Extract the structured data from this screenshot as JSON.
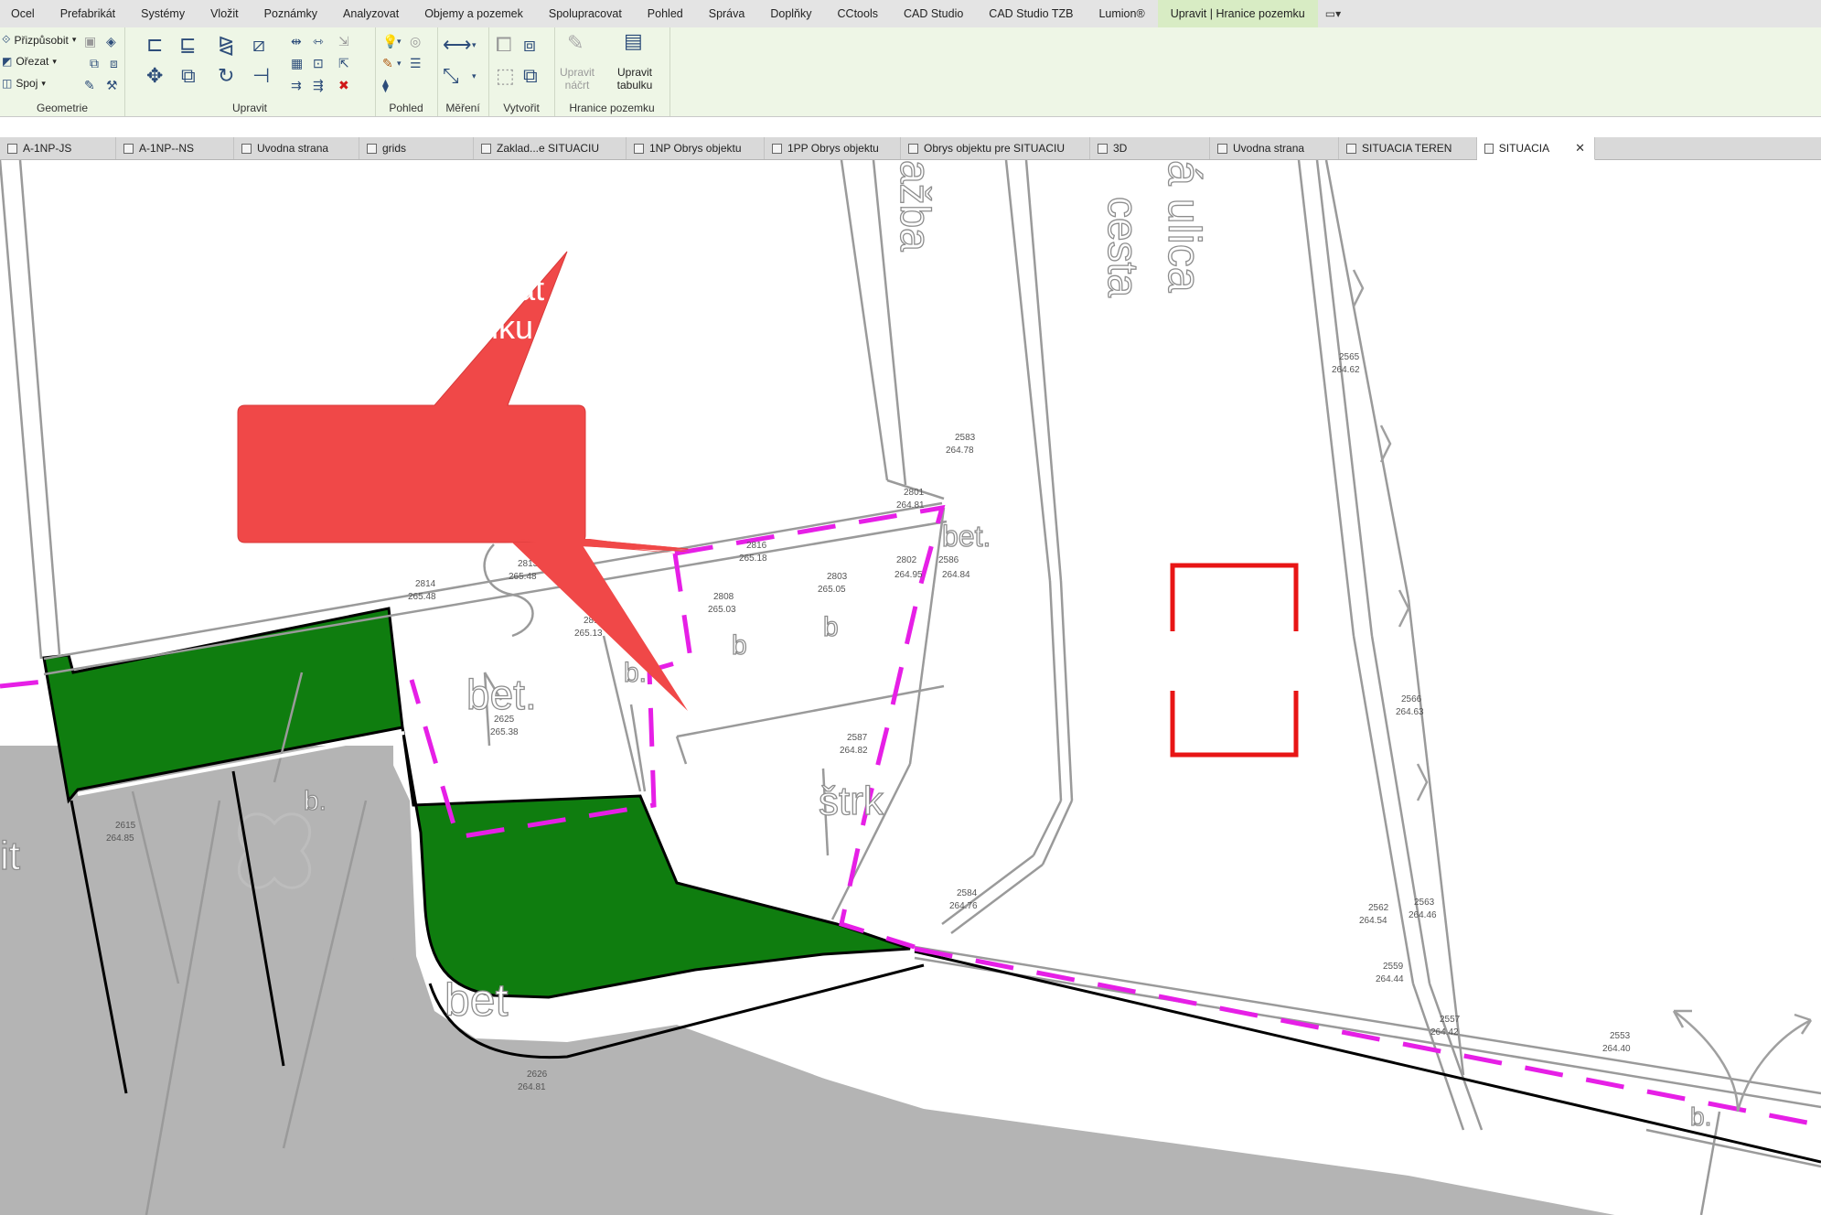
{
  "menu": {
    "items": [
      "Ocel",
      "Prefabrikát",
      "Systémy",
      "Vložit",
      "Poznámky",
      "Analyzovat",
      "Objemy a pozemek",
      "Spolupracovat",
      "Pohled",
      "Správa",
      "Doplňky",
      "CCtools",
      "CAD Studio",
      "CAD Studio TZB",
      "Lumion®",
      "Upravit | Hranice pozemku"
    ],
    "qat_icon": "switch-window-icon"
  },
  "ribbon": {
    "geometry": {
      "title": "Geometrie",
      "fit_label": "Přizpůsobit",
      "cut_label": "Ořezat",
      "join_label": "Spoj"
    },
    "modify": {
      "title": "Upravit"
    },
    "view": {
      "title": "Pohled"
    },
    "measure": {
      "title": "Měření"
    },
    "create": {
      "title": "Vytvořit"
    },
    "property_line": {
      "title": "Hranice pozemku",
      "edit_sketch_label_1": "Upravit",
      "edit_sketch_label_2": "náčrt",
      "edit_table_label": "Upravit tabulku"
    }
  },
  "tabs": [
    {
      "label": "A-1NP-JS",
      "active": false
    },
    {
      "label": "A-1NP--NS",
      "active": false
    },
    {
      "label": "Uvodna strana",
      "active": false
    },
    {
      "label": "grids",
      "active": false
    },
    {
      "label": "Zaklad...e SITUACIU",
      "active": false
    },
    {
      "label": "1NP Obrys objektu",
      "active": false
    },
    {
      "label": "1PP Obrys objektu",
      "active": false
    },
    {
      "label": "Obrys objektu pre SITUACIU",
      "active": false
    },
    {
      "label": "3D",
      "active": false
    },
    {
      "label": "Uvodna strana",
      "active": false
    },
    {
      "label": "SITUACIA TEREN",
      "active": false
    },
    {
      "label": "SITUACIA",
      "active": true
    }
  ],
  "callout": {
    "line1": "Nedaju sa editovat",
    "line2": "hranice pozemku",
    "color": "#f04848"
  },
  "map": {
    "labels": {
      "bet_1": "bet.",
      "bet_2": "bet.",
      "bet_3": "bet",
      "b_1": "b.",
      "b_2": "b",
      "b_3": "b",
      "b_4": "b.",
      "b_5": "b.",
      "strk": "štrk",
      "dlazba": "ažba",
      "cesta": "cesta",
      "ulica": "á ulica",
      "it": "it"
    },
    "points": [
      {
        "num": "2814",
        "elev": "265.48"
      },
      {
        "num": "2813",
        "elev": "265.48"
      },
      {
        "num": "2816",
        "elev": "265.18"
      },
      {
        "num": "2801",
        "elev": "264.81"
      },
      {
        "num": "2803",
        "elev": "265.05"
      },
      {
        "num": "2802",
        "elev": "264.95"
      },
      {
        "num": "2586",
        "elev": "264.84"
      },
      {
        "num": "2812",
        "elev": "265.13"
      },
      {
        "num": "2808",
        "elev": "265.03"
      },
      {
        "num": "2625",
        "elev": "265.38"
      },
      {
        "num": "2587",
        "elev": "264.82"
      },
      {
        "num": "2583",
        "elev": "264.78"
      },
      {
        "num": "2584",
        "elev": "264.76"
      },
      {
        "num": "2565",
        "elev": "264.62"
      },
      {
        "num": "2566",
        "elev": "264.63"
      },
      {
        "num": "2562",
        "elev": "264.54"
      },
      {
        "num": "2563",
        "elev": "264.46"
      },
      {
        "num": "2559",
        "elev": "264.44"
      },
      {
        "num": "2557",
        "elev": "264.42"
      },
      {
        "num": "2553",
        "elev": "264.40"
      },
      {
        "num": "2626",
        "elev": "264.81"
      },
      {
        "num": "2615",
        "elev": "264.85"
      }
    ],
    "colors": {
      "property_line": "#e61fe6",
      "green_area": "#0f7d0f",
      "road_area": "#b4b4b4",
      "highlight_box": "#e81515"
    }
  }
}
